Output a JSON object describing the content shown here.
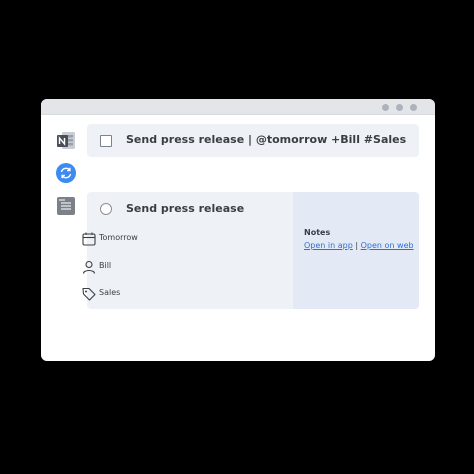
{
  "window": {
    "controls": [
      "minimize",
      "maximize",
      "close"
    ]
  },
  "sidebar": {
    "icons": [
      "onenote-icon",
      "sync-icon",
      "stack-icon"
    ],
    "sync_color": "#3d8bf0",
    "onenote_color": "#7f3fbf"
  },
  "task_input": {
    "text": "Send press release | @tomorrow +Bill #Sales"
  },
  "task_detail": {
    "title": "Send press release",
    "due": "Tomorrow",
    "assignee": "Bill",
    "tag": "Sales",
    "notes": {
      "label": "Notes",
      "open_in_app": "Open in app",
      "separator": "|",
      "open_on_web": "Open on web"
    }
  }
}
